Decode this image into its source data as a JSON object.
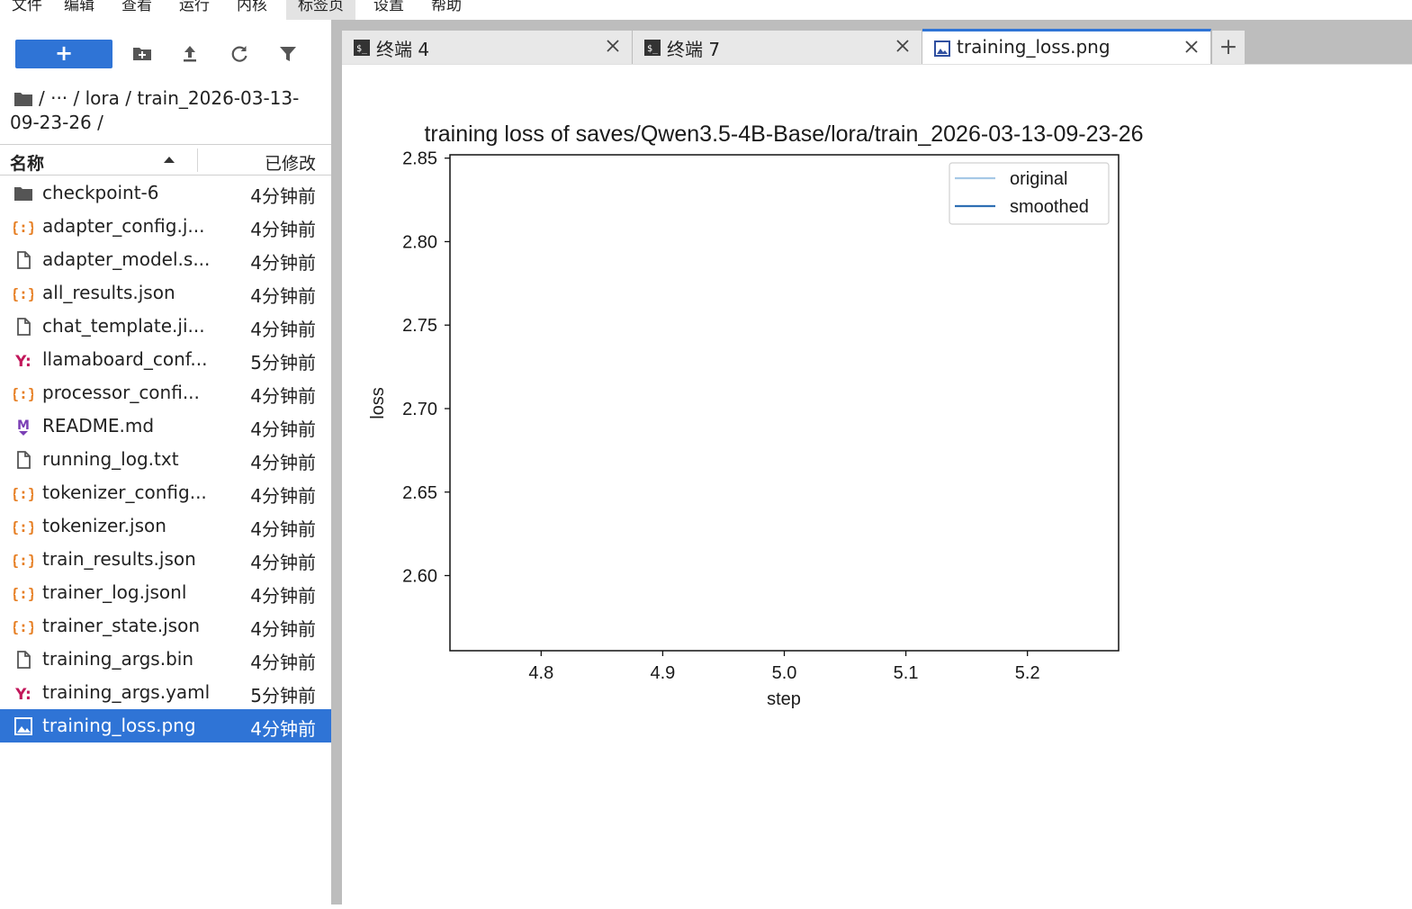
{
  "menubar": {
    "items": [
      "文件",
      "编辑",
      "查看",
      "运行",
      "内核",
      "标签页",
      "设置",
      "帮助"
    ]
  },
  "filebrowser": {
    "toolbar": {
      "new_label": "+",
      "new_folder_icon": "new-folder-icon",
      "upload_icon": "upload-icon",
      "refresh_icon": "refresh-icon",
      "filter_icon": "filter-icon"
    },
    "breadcrumb": {
      "line1": "/  ···  / lora / train_2026-03-13-",
      "line2": "09-23-26 /"
    },
    "header": {
      "name": "名称",
      "modified": "已修改"
    },
    "files": [
      {
        "icon": "folder",
        "name": "checkpoint-6",
        "modified": "4分钟前"
      },
      {
        "icon": "json",
        "name": "adapter_config.j...",
        "modified": "4分钟前"
      },
      {
        "icon": "file",
        "name": "adapter_model.s...",
        "modified": "4分钟前"
      },
      {
        "icon": "json",
        "name": "all_results.json",
        "modified": "4分钟前"
      },
      {
        "icon": "file",
        "name": "chat_template.ji...",
        "modified": "4分钟前"
      },
      {
        "icon": "yaml",
        "name": "llamaboard_conf...",
        "modified": "5分钟前"
      },
      {
        "icon": "json",
        "name": "processor_confi...",
        "modified": "4分钟前"
      },
      {
        "icon": "markdown",
        "name": "README.md",
        "modified": "4分钟前"
      },
      {
        "icon": "file",
        "name": "running_log.txt",
        "modified": "4分钟前"
      },
      {
        "icon": "json",
        "name": "tokenizer_config...",
        "modified": "4分钟前"
      },
      {
        "icon": "json",
        "name": "tokenizer.json",
        "modified": "4分钟前"
      },
      {
        "icon": "json",
        "name": "train_results.json",
        "modified": "4分钟前"
      },
      {
        "icon": "json",
        "name": "trainer_log.jsonl",
        "modified": "4分钟前"
      },
      {
        "icon": "json",
        "name": "trainer_state.json",
        "modified": "4分钟前"
      },
      {
        "icon": "file",
        "name": "training_args.bin",
        "modified": "4分钟前"
      },
      {
        "icon": "yaml",
        "name": "training_args.yaml",
        "modified": "5分钟前"
      },
      {
        "icon": "image",
        "name": "training_loss.png",
        "modified": "4分钟前",
        "selected": true
      }
    ]
  },
  "tabs": [
    {
      "label": "终端 4",
      "icon": "terminal-icon",
      "active": false
    },
    {
      "label": "终端 7",
      "icon": "terminal-icon",
      "active": false
    },
    {
      "label": "training_loss.png",
      "icon": "image-icon",
      "active": true
    }
  ],
  "tab_add_label": "+",
  "colors": {
    "accent": "#2f74d6",
    "json_icon": "#e67e22",
    "yaml_icon": "#c2185b",
    "markdown_icon": "#7b3fb5",
    "original_line": "#a6c8e6",
    "smoothed_line": "#2f6fb4"
  },
  "chart_data": {
    "type": "line",
    "title": "training loss of saves/Qwen3.5-4B-Base/lora/train_2026-03-13-09-23-26",
    "xlabel": "step",
    "ylabel": "loss",
    "xlim": [
      4.725,
      5.275
    ],
    "ylim": [
      2.555,
      2.852
    ],
    "x_ticks": [
      4.8,
      4.9,
      5.0,
      5.1,
      5.2
    ],
    "y_ticks": [
      2.6,
      2.65,
      2.7,
      2.75,
      2.8,
      2.85
    ],
    "x_tick_labels": [
      "4.8",
      "4.9",
      "5.0",
      "5.1",
      "5.2"
    ],
    "y_tick_labels": [
      "2.60",
      "2.65",
      "2.70",
      "2.75",
      "2.80",
      "2.85"
    ],
    "legend_position": "top-right",
    "grid": false,
    "series": [
      {
        "name": "original",
        "x": [],
        "values": []
      },
      {
        "name": "smoothed",
        "x": [],
        "values": []
      }
    ]
  }
}
